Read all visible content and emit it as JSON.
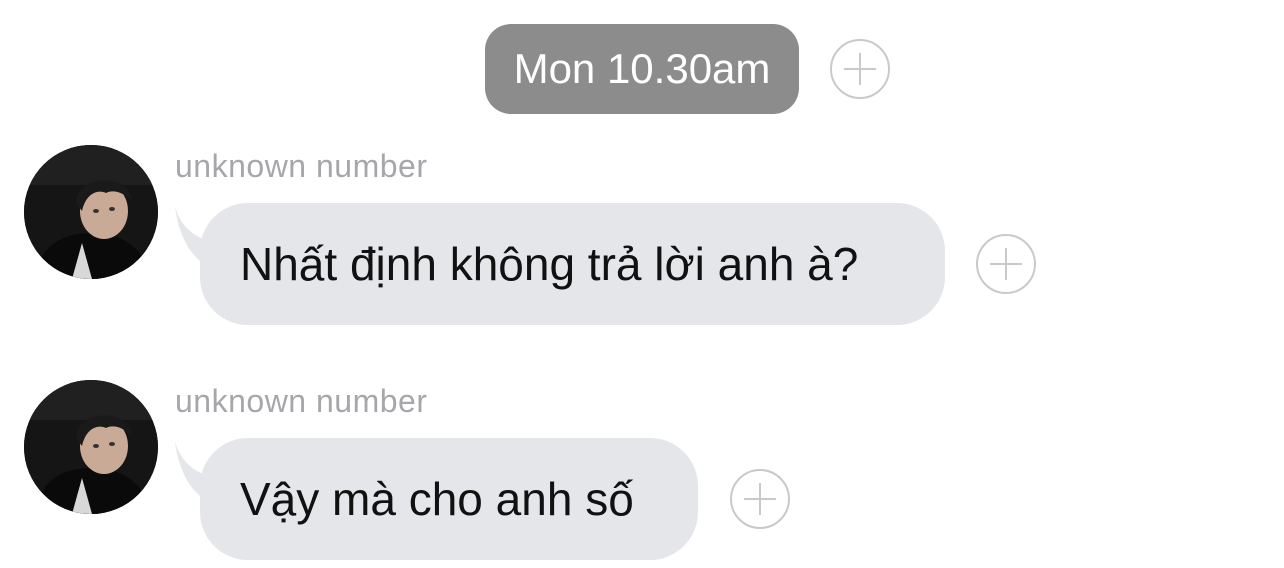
{
  "timestamp": {
    "label": "Mon 10.30am"
  },
  "messages": [
    {
      "sender": "unknown number",
      "text": "Nhất định không trả lời anh à?"
    },
    {
      "sender": "unknown number",
      "text": "Vậy mà cho anh số"
    }
  ],
  "colors": {
    "timestamp_bg": "#8c8c8c",
    "bubble_bg": "#e5e6ea",
    "sender_text": "#a7a7ab",
    "plus_outline": "#c9c9cc",
    "message_text": "#111111"
  },
  "icons": {
    "add_reaction": "plus-circle-icon"
  }
}
